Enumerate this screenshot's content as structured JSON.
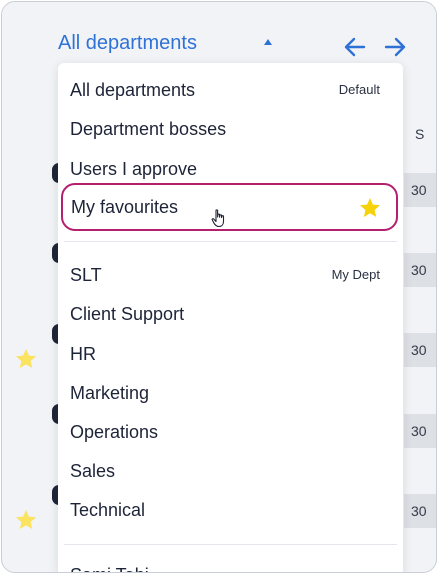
{
  "header": {
    "department_select_value": "All departments",
    "prev_icon": "arrow-left-icon",
    "next_icon": "arrow-right-icon",
    "accent_color": "#2f72d6"
  },
  "background": {
    "column_header": "S",
    "cells": [
      "30",
      "30",
      "30",
      "30",
      "30"
    ],
    "star_color": "#fbe25f"
  },
  "dropdown": {
    "groups": [
      {
        "items": [
          {
            "label": "All departments",
            "tag": "Default"
          },
          {
            "label": "Department bosses",
            "tag": ""
          },
          {
            "label": "Users I approve",
            "tag": ""
          },
          {
            "label": "My favourites",
            "tag": "",
            "selected": true,
            "icon": "star-icon"
          }
        ]
      },
      {
        "items": [
          {
            "label": "SLT",
            "tag": "My Dept"
          },
          {
            "label": "Client Support",
            "tag": ""
          },
          {
            "label": "HR",
            "tag": ""
          },
          {
            "label": "Marketing",
            "tag": ""
          },
          {
            "label": "Operations",
            "tag": ""
          },
          {
            "label": "Sales",
            "tag": ""
          },
          {
            "label": "Technical",
            "tag": ""
          }
        ]
      }
    ],
    "partial_item": "Sami Tabi",
    "selected_border_color": "#b41f6e",
    "favourite_star_color": "#f6d20a"
  }
}
